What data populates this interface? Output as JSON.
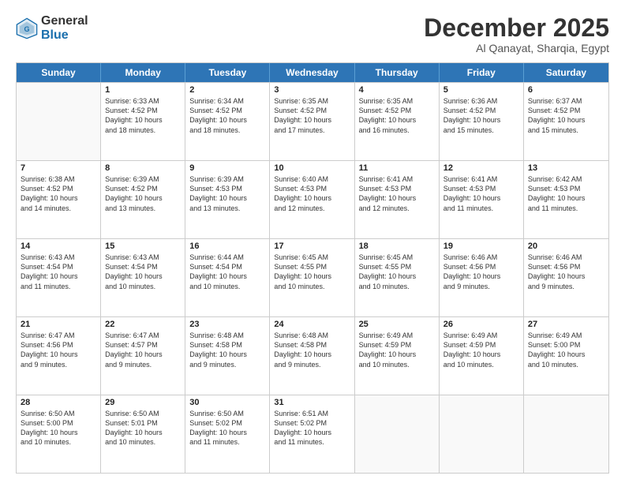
{
  "logo": {
    "general": "General",
    "blue": "Blue"
  },
  "header": {
    "title": "December 2025",
    "location": "Al Qanayat, Sharqia, Egypt"
  },
  "days": [
    "Sunday",
    "Monday",
    "Tuesday",
    "Wednesday",
    "Thursday",
    "Friday",
    "Saturday"
  ],
  "rows": [
    [
      {
        "day": "",
        "text": ""
      },
      {
        "day": "1",
        "text": "Sunrise: 6:33 AM\nSunset: 4:52 PM\nDaylight: 10 hours\nand 18 minutes."
      },
      {
        "day": "2",
        "text": "Sunrise: 6:34 AM\nSunset: 4:52 PM\nDaylight: 10 hours\nand 18 minutes."
      },
      {
        "day": "3",
        "text": "Sunrise: 6:35 AM\nSunset: 4:52 PM\nDaylight: 10 hours\nand 17 minutes."
      },
      {
        "day": "4",
        "text": "Sunrise: 6:35 AM\nSunset: 4:52 PM\nDaylight: 10 hours\nand 16 minutes."
      },
      {
        "day": "5",
        "text": "Sunrise: 6:36 AM\nSunset: 4:52 PM\nDaylight: 10 hours\nand 15 minutes."
      },
      {
        "day": "6",
        "text": "Sunrise: 6:37 AM\nSunset: 4:52 PM\nDaylight: 10 hours\nand 15 minutes."
      }
    ],
    [
      {
        "day": "7",
        "text": "Sunrise: 6:38 AM\nSunset: 4:52 PM\nDaylight: 10 hours\nand 14 minutes."
      },
      {
        "day": "8",
        "text": "Sunrise: 6:39 AM\nSunset: 4:52 PM\nDaylight: 10 hours\nand 13 minutes."
      },
      {
        "day": "9",
        "text": "Sunrise: 6:39 AM\nSunset: 4:53 PM\nDaylight: 10 hours\nand 13 minutes."
      },
      {
        "day": "10",
        "text": "Sunrise: 6:40 AM\nSunset: 4:53 PM\nDaylight: 10 hours\nand 12 minutes."
      },
      {
        "day": "11",
        "text": "Sunrise: 6:41 AM\nSunset: 4:53 PM\nDaylight: 10 hours\nand 12 minutes."
      },
      {
        "day": "12",
        "text": "Sunrise: 6:41 AM\nSunset: 4:53 PM\nDaylight: 10 hours\nand 11 minutes."
      },
      {
        "day": "13",
        "text": "Sunrise: 6:42 AM\nSunset: 4:53 PM\nDaylight: 10 hours\nand 11 minutes."
      }
    ],
    [
      {
        "day": "14",
        "text": "Sunrise: 6:43 AM\nSunset: 4:54 PM\nDaylight: 10 hours\nand 11 minutes."
      },
      {
        "day": "15",
        "text": "Sunrise: 6:43 AM\nSunset: 4:54 PM\nDaylight: 10 hours\nand 10 minutes."
      },
      {
        "day": "16",
        "text": "Sunrise: 6:44 AM\nSunset: 4:54 PM\nDaylight: 10 hours\nand 10 minutes."
      },
      {
        "day": "17",
        "text": "Sunrise: 6:45 AM\nSunset: 4:55 PM\nDaylight: 10 hours\nand 10 minutes."
      },
      {
        "day": "18",
        "text": "Sunrise: 6:45 AM\nSunset: 4:55 PM\nDaylight: 10 hours\nand 10 minutes."
      },
      {
        "day": "19",
        "text": "Sunrise: 6:46 AM\nSunset: 4:56 PM\nDaylight: 10 hours\nand 9 minutes."
      },
      {
        "day": "20",
        "text": "Sunrise: 6:46 AM\nSunset: 4:56 PM\nDaylight: 10 hours\nand 9 minutes."
      }
    ],
    [
      {
        "day": "21",
        "text": "Sunrise: 6:47 AM\nSunset: 4:56 PM\nDaylight: 10 hours\nand 9 minutes."
      },
      {
        "day": "22",
        "text": "Sunrise: 6:47 AM\nSunset: 4:57 PM\nDaylight: 10 hours\nand 9 minutes."
      },
      {
        "day": "23",
        "text": "Sunrise: 6:48 AM\nSunset: 4:58 PM\nDaylight: 10 hours\nand 9 minutes."
      },
      {
        "day": "24",
        "text": "Sunrise: 6:48 AM\nSunset: 4:58 PM\nDaylight: 10 hours\nand 9 minutes."
      },
      {
        "day": "25",
        "text": "Sunrise: 6:49 AM\nSunset: 4:59 PM\nDaylight: 10 hours\nand 10 minutes."
      },
      {
        "day": "26",
        "text": "Sunrise: 6:49 AM\nSunset: 4:59 PM\nDaylight: 10 hours\nand 10 minutes."
      },
      {
        "day": "27",
        "text": "Sunrise: 6:49 AM\nSunset: 5:00 PM\nDaylight: 10 hours\nand 10 minutes."
      }
    ],
    [
      {
        "day": "28",
        "text": "Sunrise: 6:50 AM\nSunset: 5:00 PM\nDaylight: 10 hours\nand 10 minutes."
      },
      {
        "day": "29",
        "text": "Sunrise: 6:50 AM\nSunset: 5:01 PM\nDaylight: 10 hours\nand 10 minutes."
      },
      {
        "day": "30",
        "text": "Sunrise: 6:50 AM\nSunset: 5:02 PM\nDaylight: 10 hours\nand 11 minutes."
      },
      {
        "day": "31",
        "text": "Sunrise: 6:51 AM\nSunset: 5:02 PM\nDaylight: 10 hours\nand 11 minutes."
      },
      {
        "day": "",
        "text": ""
      },
      {
        "day": "",
        "text": ""
      },
      {
        "day": "",
        "text": ""
      }
    ]
  ]
}
